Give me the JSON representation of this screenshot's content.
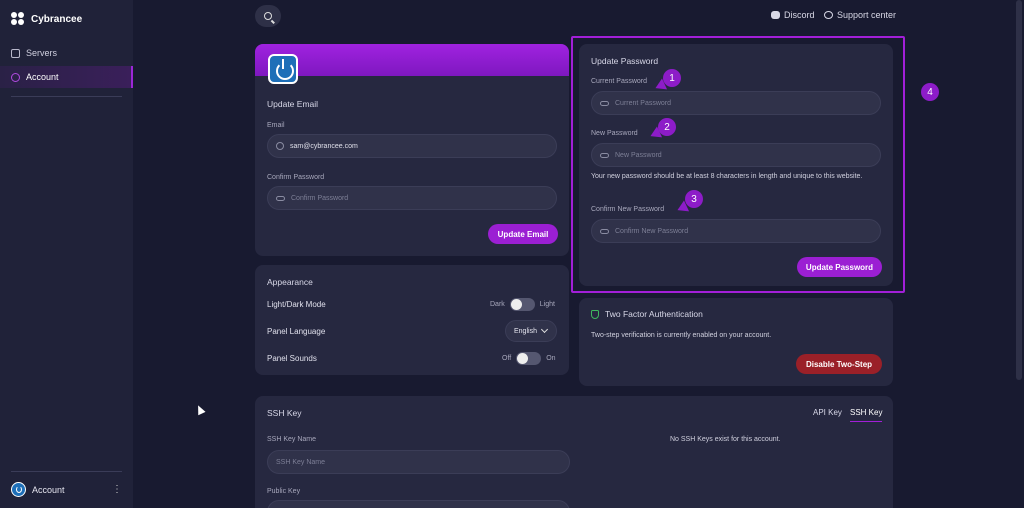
{
  "brand": {
    "name": "Cybrancee"
  },
  "sidebar": {
    "items": [
      {
        "label": "Servers",
        "icon": "server-icon"
      },
      {
        "label": "Account",
        "icon": "account-icon",
        "active": true
      }
    ],
    "footer_label": "Account"
  },
  "topbar": {
    "discord_label": "Discord",
    "support_label": "Support center"
  },
  "email_card": {
    "title": "Update Email",
    "email_label": "Email",
    "email_value": "sam@cybrancee.com",
    "confirm_label": "Confirm Password",
    "confirm_placeholder": "Confirm Password",
    "button_label": "Update Email"
  },
  "appearance": {
    "title": "Appearance",
    "mode_label": "Light/Dark Mode",
    "mode_left": "Dark",
    "mode_right": "Light",
    "lang_label": "Panel Language",
    "lang_value": "English",
    "sounds_label": "Panel Sounds",
    "sounds_left": "Off",
    "sounds_right": "On"
  },
  "password_card": {
    "title": "Update Password",
    "current_label": "Current Password",
    "current_placeholder": "Current Password",
    "new_label": "New Password",
    "new_placeholder": "New Password",
    "help": "Your new password should be at least 8 characters in length and unique to this website.",
    "confirm_label": "Confirm New Password",
    "confirm_placeholder": "Confirm New Password",
    "button_label": "Update Password"
  },
  "twofa": {
    "title": "Two Factor Authentication",
    "status": "Two-step verification is currently enabled on your account.",
    "button_label": "Disable Two-Step"
  },
  "ssh": {
    "title": "SSH Key",
    "tabs": [
      "API Key",
      "SSH Key"
    ],
    "name_label": "SSH Key Name",
    "name_placeholder": "SSH Key Name",
    "public_key_label": "Public Key",
    "empty_message": "No SSH Keys exist for this account."
  },
  "annotations": [
    "1",
    "2",
    "3",
    "4"
  ],
  "colors": {
    "accent": "#9b1fd3",
    "danger": "#9a2028",
    "background": "#181a30",
    "card": "#262840"
  }
}
